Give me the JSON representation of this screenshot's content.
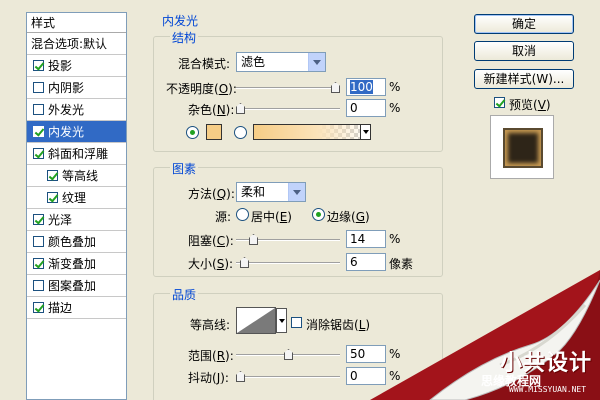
{
  "styles_panel": {
    "header": "样式",
    "blend": "混合选项:默认",
    "items": [
      {
        "label": "投影",
        "checked": true
      },
      {
        "label": "内阴影",
        "checked": false
      },
      {
        "label": "外发光",
        "checked": false
      },
      {
        "label": "内发光",
        "checked": true,
        "selected": true
      },
      {
        "label": "斜面和浮雕",
        "checked": true
      },
      {
        "label": "等高线",
        "checked": true,
        "sub": true
      },
      {
        "label": "纹理",
        "checked": true,
        "sub": true
      },
      {
        "label": "光泽",
        "checked": true
      },
      {
        "label": "颜色叠加",
        "checked": false
      },
      {
        "label": "渐变叠加",
        "checked": true
      },
      {
        "label": "图案叠加",
        "checked": false
      },
      {
        "label": "描边",
        "checked": true
      }
    ]
  },
  "panel_title": "内发光",
  "structure": {
    "title": "结构",
    "blend_mode_label": "混合模式:",
    "blend_mode_value": "滤色",
    "opacity_label_pre": "不透明度(",
    "opacity_key": "O",
    "opacity_label_post": "):",
    "opacity_value": "100",
    "opacity_unit": "%",
    "opacity_level": 1.0,
    "noise_label_pre": "杂色(",
    "noise_key": "N",
    "noise_label_post": "):",
    "noise_value": "0",
    "noise_unit": "%",
    "noise_level": 0.0
  },
  "elements": {
    "title": "图素",
    "method_label_pre": "方法(",
    "method_key": "Q",
    "method_label_post": "):",
    "method_value": "柔和",
    "source_label": "源:",
    "source_center_pre": "居中(",
    "source_center_key": "E",
    "source_center_post": ")",
    "source_edge_pre": "边缘(",
    "source_edge_key": "G",
    "source_edge_post": ")",
    "choke_label_pre": "阻塞(",
    "choke_key": "C",
    "choke_label_post": "):",
    "choke_value": "14",
    "choke_unit": "%",
    "choke_level": 0.14,
    "size_label_pre": "大小(",
    "size_key": "S",
    "size_label_post": "):",
    "size_value": "6",
    "size_unit": "像素",
    "size_level": 0.04
  },
  "quality": {
    "title": "品质",
    "contour_label": "等高线:",
    "antialias_pre": "消除锯齿(",
    "antialias_key": "L",
    "antialias_post": ")",
    "range_label_pre": "范围(",
    "range_key": "R",
    "range_label_post": "):",
    "range_value": "50",
    "range_unit": "%",
    "range_level": 0.5,
    "jitter_label_pre": "抖动(",
    "jitter_key": "J",
    "jitter_label_post": "):",
    "jitter_value": "0",
    "jitter_unit": "%",
    "jitter_level": 0.0
  },
  "buttons": {
    "ok": "确定",
    "cancel": "取消",
    "new_style": "新建样式(W)...",
    "preview_pre": "预览(",
    "preview_key": "V",
    "preview_post": ")"
  },
  "watermark": {
    "logo": "小共设计",
    "sub": "思缘教程网",
    "url": "WWW.MISSYUAN.NET"
  },
  "colors": {
    "glow_color": "#f6cd86",
    "selection": "#316ac5",
    "group_title": "#0046d5",
    "curl_red": "#a3141b"
  }
}
